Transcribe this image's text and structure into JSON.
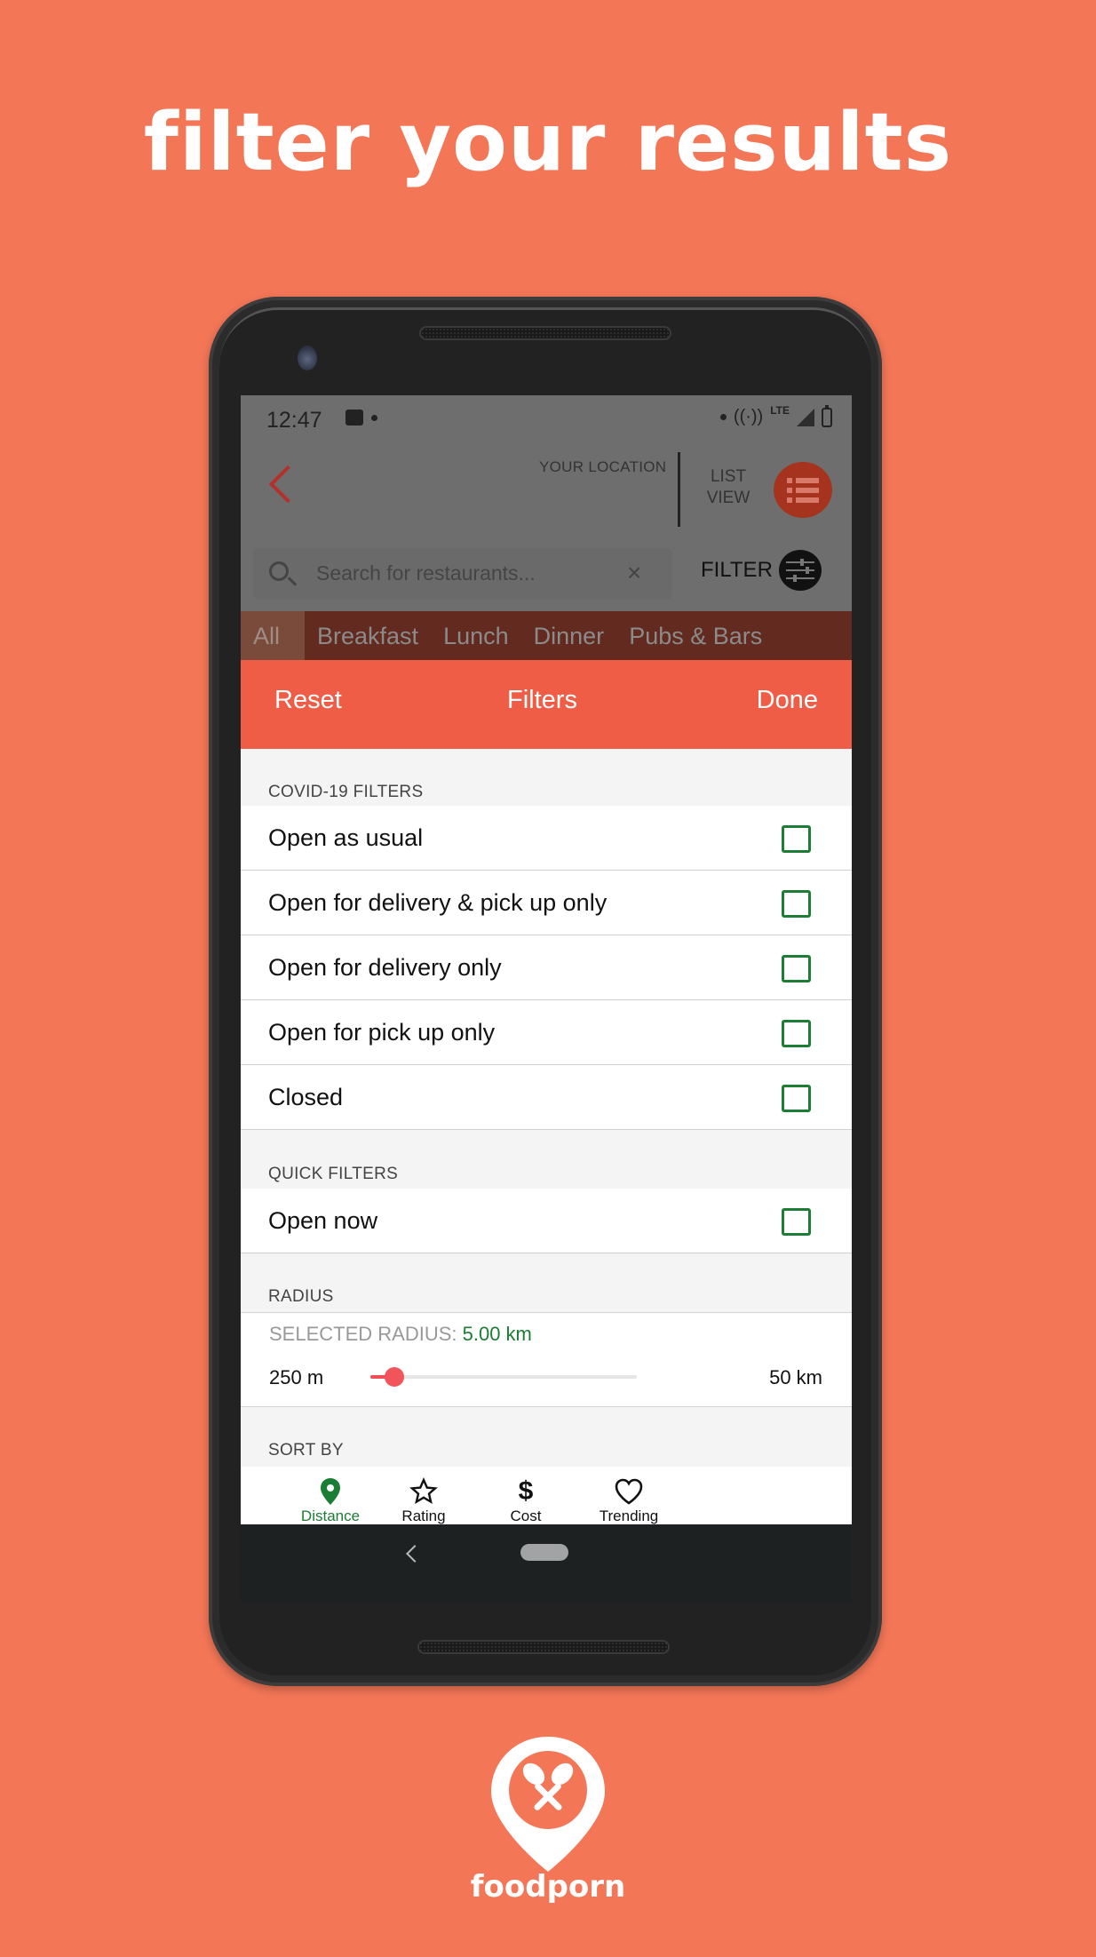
{
  "headline": "filter your results",
  "status_bar": {
    "time": "12:47",
    "network": "LTE",
    "icons": [
      "notification-icon",
      "hotspot-icon",
      "signal-icon",
      "battery-charging-icon"
    ]
  },
  "header": {
    "back_icon": "chevron-left-icon",
    "location_label": "YOUR LOCATION",
    "list_view_label_1": "LIST",
    "list_view_label_2": "VIEW",
    "list_view_icon": "list-icon"
  },
  "search": {
    "placeholder": "Search for restaurants...",
    "value": "",
    "search_icon": "search-icon",
    "clear_icon": "close-icon",
    "filter_label": "FILTER",
    "filter_icon": "sliders-icon"
  },
  "categories": [
    {
      "label": "All",
      "active": true
    },
    {
      "label": "Breakfast",
      "active": false
    },
    {
      "label": "Lunch",
      "active": false
    },
    {
      "label": "Dinner",
      "active": false
    },
    {
      "label": "Pubs & Bars",
      "active": false
    }
  ],
  "filters_sheet": {
    "reset_label": "Reset",
    "title": "Filters",
    "done_label": "Done",
    "covid_section": {
      "label": "COVID-19 FILTERS",
      "options": [
        {
          "label": "Open as usual",
          "checked": false
        },
        {
          "label": "Open for delivery & pick up only",
          "checked": false
        },
        {
          "label": "Open for delivery only",
          "checked": false
        },
        {
          "label": "Open for pick up only",
          "checked": false
        },
        {
          "label": "Closed",
          "checked": false
        }
      ]
    },
    "quick_section": {
      "label": "QUICK FILTERS",
      "options": [
        {
          "label": "Open now",
          "checked": false
        }
      ]
    },
    "radius_section": {
      "label": "RADIUS",
      "selected_label": "SELECTED RADIUS: ",
      "selected_value": "5.00 km",
      "min_label": "250 m",
      "max_label": "50 km",
      "slider_fraction": 0.09
    },
    "sort_section": {
      "label": "SORT BY",
      "options": [
        {
          "label": "Distance",
          "icon": "location-pin-icon",
          "active": true
        },
        {
          "label": "Rating",
          "icon": "star-icon",
          "active": false
        },
        {
          "label": "Cost",
          "icon": "dollar-icon",
          "active": false
        },
        {
          "label": "Trending",
          "icon": "heart-icon",
          "active": false
        }
      ]
    }
  },
  "brand": {
    "name": "foodporn",
    "logo_icon": "map-pin-spoons-icon"
  },
  "colors": {
    "background": "#f37657",
    "accent": "#ef5d47",
    "check_green": "#1c7d34",
    "slider_red": "#f2545b"
  }
}
